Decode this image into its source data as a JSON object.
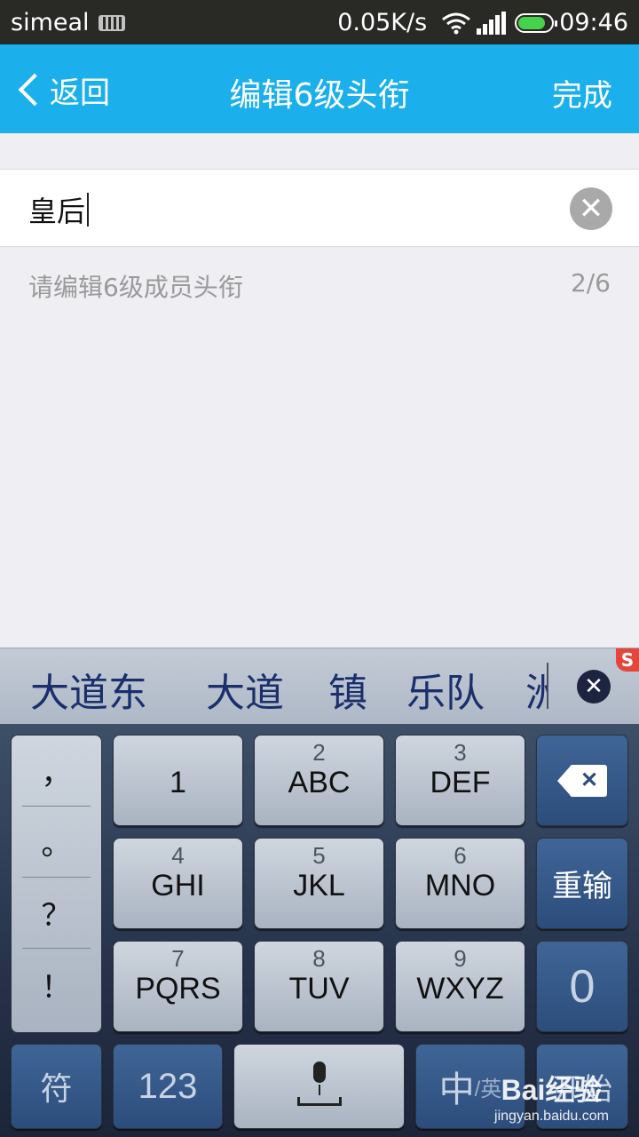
{
  "status_bar": {
    "carrier": "simeal",
    "speed": "0.05K/s",
    "time": "09:46"
  },
  "nav": {
    "back_label": "返回",
    "title": "编辑6级头衔",
    "done_label": "完成"
  },
  "input": {
    "value": "皇后"
  },
  "hint": {
    "text": "请编辑6级成员头衔",
    "counter": "2/6"
  },
  "candidates": [
    "大道东",
    "大道",
    "镇",
    "乐队",
    "洲"
  ],
  "sogou_logo": "S",
  "keyboard": {
    "punctuation": [
      "，",
      "。",
      "？",
      "！"
    ],
    "keys": [
      {
        "num": "",
        "letters": "1"
      },
      {
        "num": "2",
        "letters": "ABC"
      },
      {
        "num": "3",
        "letters": "DEF"
      },
      {
        "num": "4",
        "letters": "GHI"
      },
      {
        "num": "5",
        "letters": "JKL"
      },
      {
        "num": "6",
        "letters": "MNO"
      },
      {
        "num": "7",
        "letters": "PQRS"
      },
      {
        "num": "8",
        "letters": "TUV"
      },
      {
        "num": "9",
        "letters": "WXYZ"
      }
    ],
    "reinput_label": "重输",
    "zero_label": "0",
    "symbol_label": "符",
    "num_label": "123",
    "lang_main": "中",
    "lang_alt": "/英",
    "start_label": "开始"
  },
  "watermark": {
    "brand": "Bai经验",
    "url": "jingyan.baidu.com"
  }
}
